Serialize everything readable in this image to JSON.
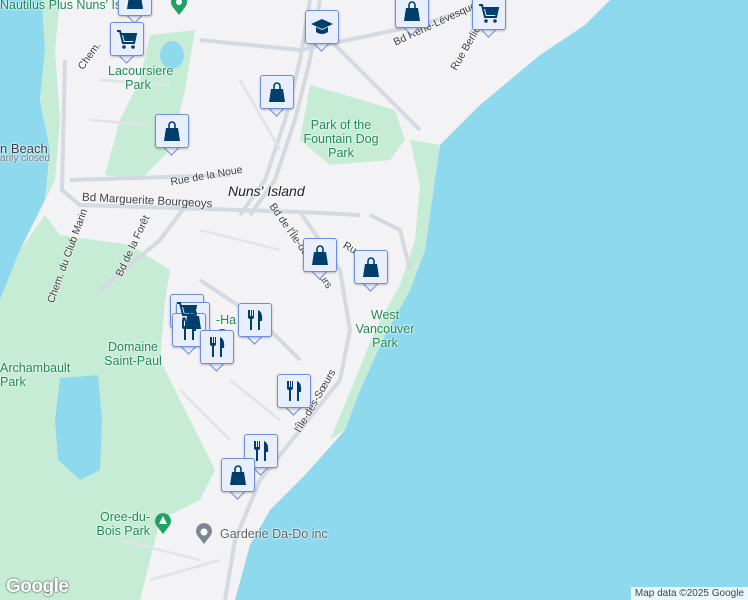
{
  "colors": {
    "water": "#8fd9ef",
    "land": "#f3f2f4",
    "park": "#c6ecd5",
    "road": "#d5d9e0",
    "marker": "#003f6b",
    "park_text": "#1e8a5a"
  },
  "labels": {
    "nautilus": "Nautilus Plus Nuns' Island",
    "lacoursiere": "Lacoursiere Park",
    "beach": "n Beach",
    "beach_status": "arily closed",
    "park_fountain": "Park of the Fountain Dog Park",
    "nuns_island": "Nuns' Island",
    "rue_noue": "Rue de la Noue",
    "bd_marguerite": "Bd Marguerite Bourgeoys",
    "chem": "Chem.",
    "chem_club_marin": "Chem. du Club Marin",
    "bd_foret": "Bd de la Forêt",
    "bd_ile_soeurs": "Bd de l'Île-des-Sœurs",
    "bd_ile_soeurs_2": "l'Île-des-Sœurs",
    "rue_berlioz": "Rue Berlioz",
    "bd_leves": "Bd René-Lévesque",
    "rue_short": "Ru",
    "west_vancouver": "West Vancouver Park",
    "domaine": "Domaine Saint-Paul",
    "archambault": "Archambault Park",
    "ha_park": "-Ha Pa",
    "oree": "Oree-du-Bois Park",
    "garderie": "Garderie Da-Do inc"
  },
  "markers": [
    {
      "type": "shopping-bag"
    },
    {
      "type": "shopping-cart"
    },
    {
      "type": "graduation-cap"
    },
    {
      "type": "shopping-bag"
    },
    {
      "type": "shopping-cart"
    },
    {
      "type": "shopping-bag"
    },
    {
      "type": "shopping-bag"
    },
    {
      "type": "shopping-bag"
    },
    {
      "type": "shopping-cart"
    },
    {
      "type": "shopping-bag"
    },
    {
      "type": "shopping-bag"
    },
    {
      "type": "restaurant"
    },
    {
      "type": "restaurant"
    },
    {
      "type": "restaurant"
    },
    {
      "type": "restaurant"
    },
    {
      "type": "restaurant"
    },
    {
      "type": "shopping-bag"
    }
  ],
  "branding": {
    "logo": "Google",
    "attribution": "Map data ©2025 Google"
  }
}
